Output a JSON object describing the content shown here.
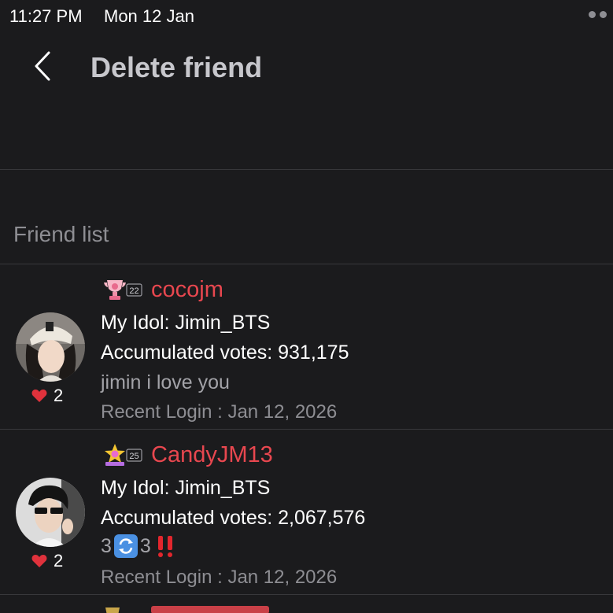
{
  "status_bar": {
    "time": "11:27 PM",
    "date": "Mon 12 Jan"
  },
  "header": {
    "title": "Delete friend",
    "back_icon": "chevron-left-icon"
  },
  "section": {
    "label": "Friend list"
  },
  "friends": [
    {
      "name": "cocojm",
      "level": "22",
      "badge_icon": "trophy-badge-icon",
      "idol": "My Idol: Jimin_BTS",
      "votes": "Accumulated votes: 931,175",
      "status_message": "jimin i love you",
      "recent_login": "Recent Login : Jan 12, 2026",
      "likes": "2"
    },
    {
      "name": "CandyJM13",
      "level": "25",
      "badge_icon": "star-badge-icon",
      "idol": "My Idol: Jimin_BTS",
      "votes": "Accumulated votes: 2,067,576",
      "status_left": "3",
      "status_right": "3",
      "status_icons": [
        "repeat-emoji-icon",
        "double-exclamation-icon"
      ],
      "recent_login": "Recent Login : Jan 12, 2026",
      "likes": "2"
    }
  ],
  "colors": {
    "background": "#1b1b1d",
    "name_accent": "#e8474f",
    "heart": "#e0323c",
    "secondary_text": "#8e8e93"
  }
}
